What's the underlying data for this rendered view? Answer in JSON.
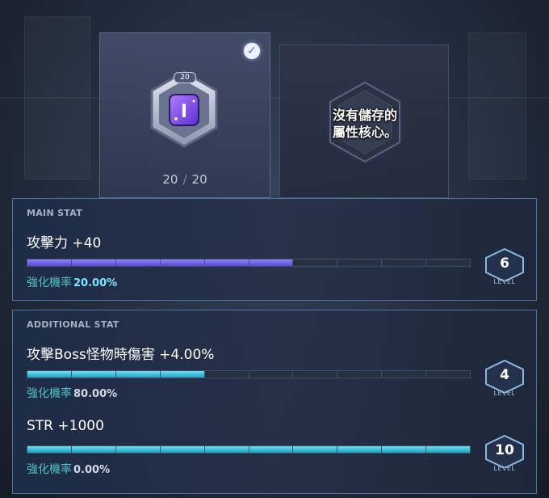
{
  "slots": {
    "equipped": {
      "emblem_level": "20",
      "emblem_glyph": "I",
      "current": "20",
      "separator": "/",
      "max": "20"
    },
    "stored": {
      "empty_text_line1": "沒有儲存的",
      "empty_text_line2": "屬性核心。"
    }
  },
  "main_stat": {
    "title": "MAIN STAT",
    "name": "攻擊力 +40",
    "rate_label": "強化機率",
    "rate_value": "20.00%",
    "level": "6",
    "level_label": "LEVEL",
    "bar_fraction": 0.6
  },
  "additional_stat": {
    "title": "ADDITIONAL STAT",
    "stats": [
      {
        "name": "攻擊Boss怪物時傷害 +4.00%",
        "rate_label": "強化機率",
        "rate_value": "80.00%",
        "level": "4",
        "level_label": "LEVEL",
        "bar_fraction": 0.4
      },
      {
        "name": "STR +1000",
        "rate_label": "強化機率",
        "rate_value": "0.00%",
        "level": "10",
        "level_label": "LEVEL",
        "bar_fraction": 1.0
      }
    ]
  },
  "colors": {
    "main_bar": "#5a47d8",
    "additional_bar": "#1fa0c0",
    "rate_text": "#4fc2c8"
  },
  "icons": {
    "selected": "check-circle-icon",
    "level": "hexagon-level-icon"
  }
}
